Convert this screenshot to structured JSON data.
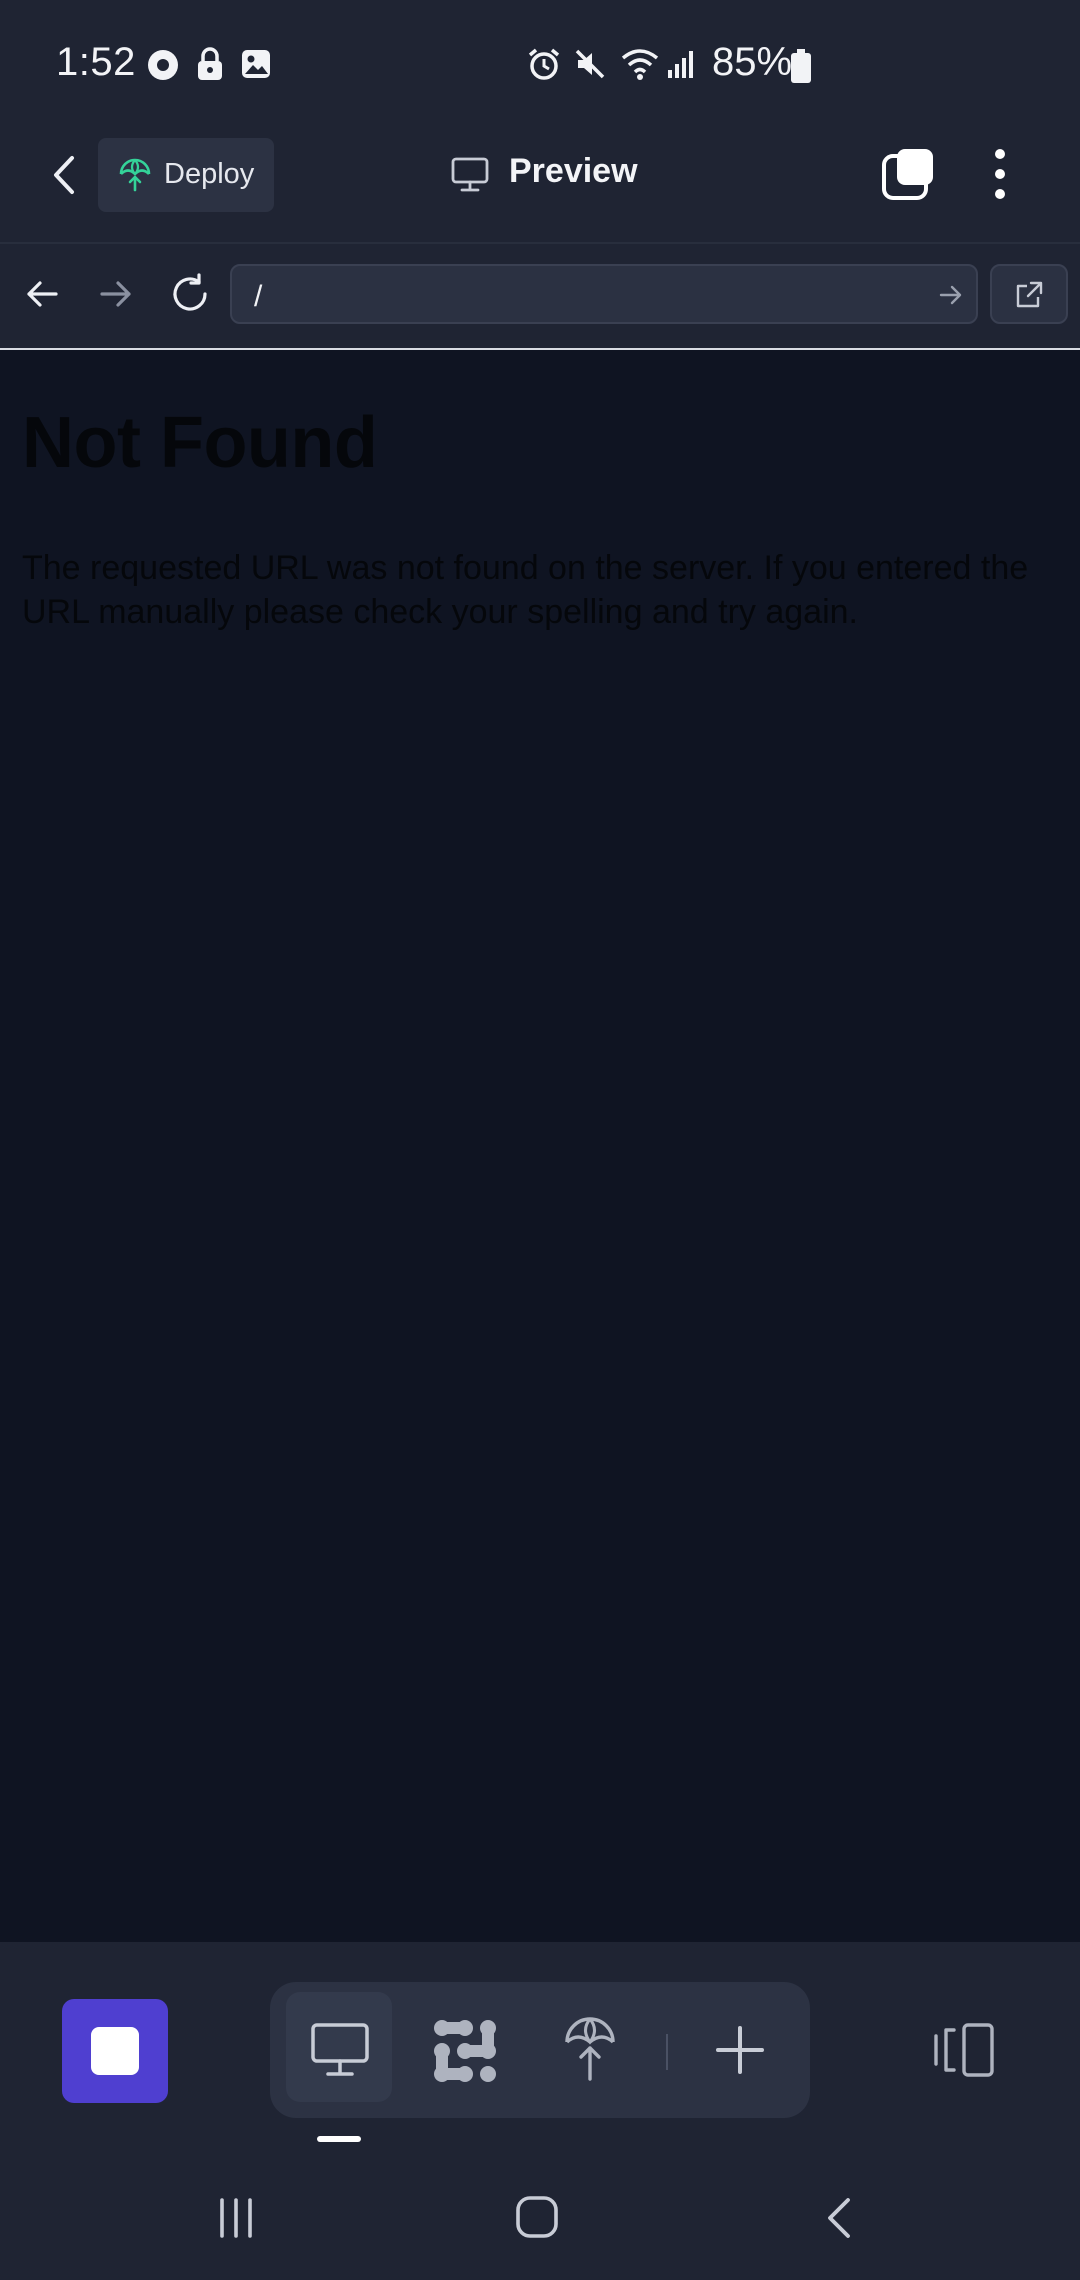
{
  "status_bar": {
    "time": "1:52",
    "battery": "85%",
    "icons": [
      "media-icon",
      "lock-icon",
      "gallery-icon",
      "alarm-icon",
      "mute-icon",
      "wifi-icon",
      "signal-icon",
      "battery-icon"
    ]
  },
  "header": {
    "deploy_label": "Deploy",
    "title": "Preview"
  },
  "browser": {
    "url": "/"
  },
  "page": {
    "heading": "Not Found",
    "message": "The requested URL was not found on the server. If you entered the URL manually please check your spelling and try again."
  },
  "bottom_bar": {
    "tabs": [
      "preview-icon",
      "workflows-icon",
      "deployments-icon",
      "add-icon"
    ],
    "active_tab": "preview-icon",
    "accent_color": "#4f3fd0"
  }
}
